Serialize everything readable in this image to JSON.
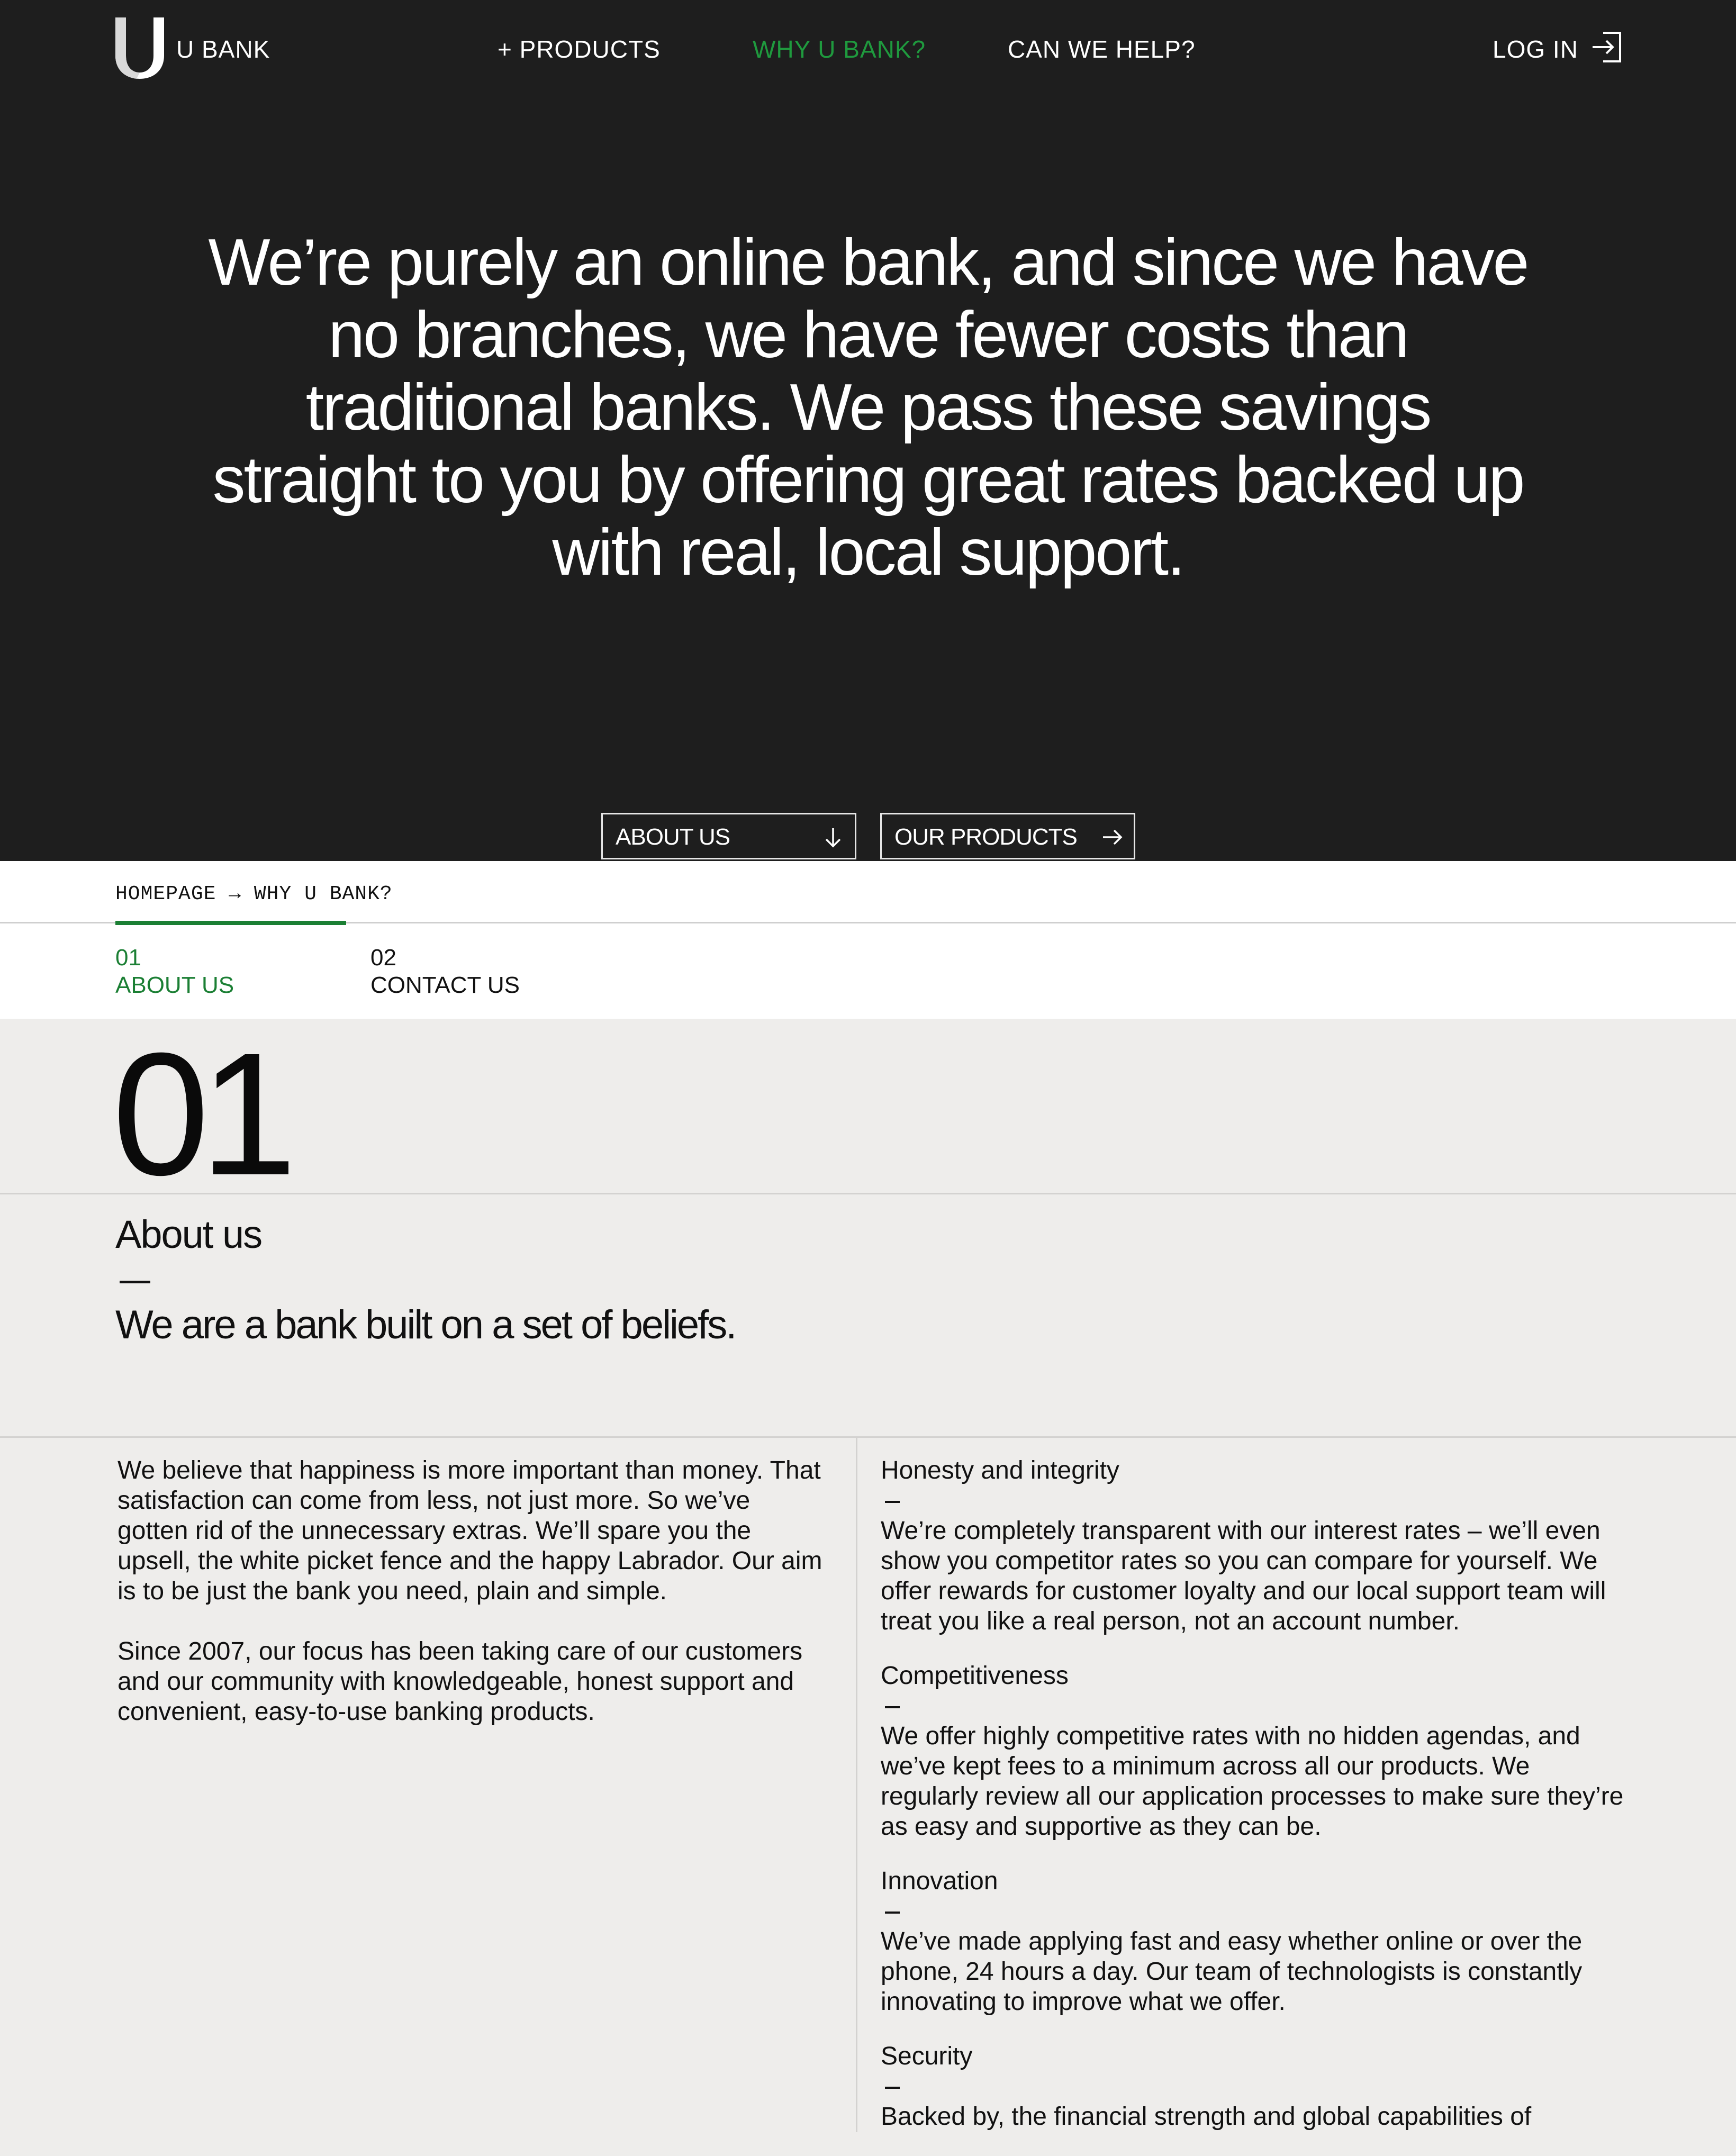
{
  "nav": {
    "brand": "U BANK",
    "products": "+ PRODUCTS",
    "why": "WHY U BANK?",
    "help": "CAN WE HELP?",
    "login": "LOG IN",
    "accent_color": "#1f9a3e"
  },
  "hero": {
    "text": "We’re purely an online bank, and since we have no branches, we have fewer costs than traditional banks. We pass these savings straight to you by offering great rates backed up with real, local support.",
    "about_btn": "ABOUT US",
    "products_btn": "OUR PRODUCTS"
  },
  "breadcrumb": {
    "home": "HOMEPAGE",
    "arrow": "→",
    "current": "WHY U BANK?"
  },
  "tabs": [
    {
      "num": "01",
      "label": "ABOUT US"
    },
    {
      "num": "02",
      "label": "CONTACT US"
    }
  ],
  "section": {
    "number": "01",
    "title": "About us",
    "subtitle": "We are a bank built on a set of beliefs.",
    "paragraphs": [
      "We believe that happiness is more important than money. That satisfaction can come from less, not just more. So we’ve gotten rid of the unnecessary extras. We’ll spare you the upsell, the white picket fence and the happy Labrador.  Our aim is to be just the bank you need, plain and simple.",
      "Since 2007, our focus has been taking care of our customers and our community with knowledgeable, honest support and convenient, easy-to-use banking products."
    ],
    "beliefs": [
      {
        "title": "Honesty and integrity",
        "text": "We’re completely transparent with our interest rates – we’ll even show you competitor rates so you can compare for yourself. We offer rewards for customer loyalty and our local support team will treat you like a real person, not an account number."
      },
      {
        "title": "Competitiveness",
        "text": "We offer highly competitive rates with no hidden agendas, and we’ve kept fees to a minimum across all our products. We regularly review all our application processes to make sure they’re as easy and supportive as they can be."
      },
      {
        "title": "Innovation",
        "text": "We’ve made applying fast and easy whether online or over the phone, 24 hours a day. Our team of technologists is constantly innovating to improve what we offer."
      },
      {
        "title": "Security",
        "text": "Backed by, the financial strength and global capabilities of"
      }
    ]
  }
}
